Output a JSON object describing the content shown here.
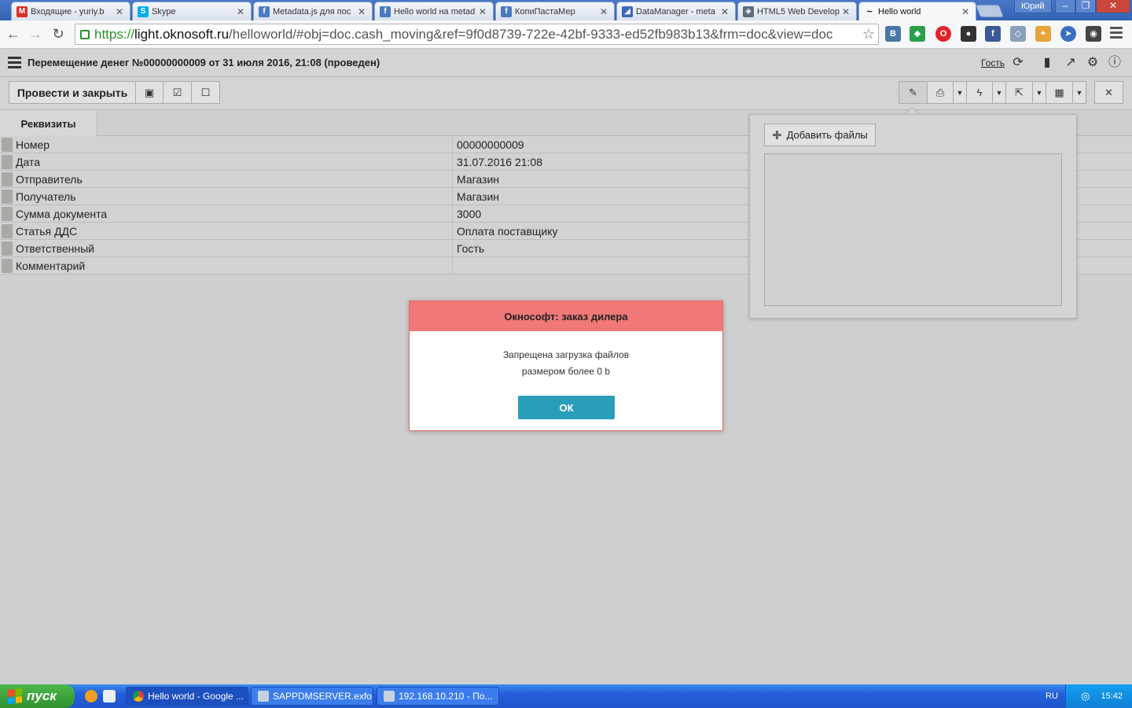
{
  "browser": {
    "tabs": [
      {
        "label": "Входящие - yuriy.b",
        "color": "#d93025",
        "glyph": "M"
      },
      {
        "label": "Skype",
        "color": "#00aff0",
        "glyph": "S"
      },
      {
        "label": "Metadata.js для пос",
        "color": "#4c79c4",
        "glyph": "f"
      },
      {
        "label": "Hello world на metad",
        "color": "#4c79c4",
        "glyph": "f"
      },
      {
        "label": "КопиПастаМер",
        "color": "#4c79c4",
        "glyph": "f"
      },
      {
        "label": "DataManager - meta",
        "color": "#3a68b8",
        "glyph": "◢"
      },
      {
        "label": "HTML5 Web Develop",
        "color": "#5f6b7a",
        "glyph": "◈"
      },
      {
        "label": "Hello world",
        "color": "#333333",
        "glyph": "~"
      }
    ],
    "window_user": "Юрий",
    "url": {
      "scheme": "https://",
      "host": "light.oknosoft.ru",
      "path": "/helloworld/#obj=doc.cash_moving&ref=9f0d8739-722e-42bf-9333-ed52fb983b13&frm=doc&view=doc"
    }
  },
  "app": {
    "title": "Перемещение денег №00000000009 от 31 июля 2016, 21:08 (проведен)",
    "user_link": "Гость"
  },
  "form_toolbar": {
    "post_close_label": "Провести и закрыть"
  },
  "form": {
    "tab_label": "Реквизиты",
    "fields": [
      {
        "label": "Номер",
        "value": "00000000009"
      },
      {
        "label": "Дата",
        "value": "31.07.2016 21:08"
      },
      {
        "label": "Отправитель",
        "value": "Магазин"
      },
      {
        "label": "Получатель",
        "value": "Магазин"
      },
      {
        "label": "Сумма документа",
        "value": "3000"
      },
      {
        "label": "Статья ДДС",
        "value": "Оплата поставщику"
      },
      {
        "label": "Ответственный",
        "value": "Гость"
      },
      {
        "label": "Комментарий",
        "value": ""
      }
    ]
  },
  "attachments": {
    "add_files_label": "Добавить файлы"
  },
  "modal": {
    "title": "Окнософт: заказ дилера",
    "message_line1": "Запрещена загрузка файлов",
    "message_line2": "размером более 0 b",
    "ok_label": "ОК"
  },
  "taskbar": {
    "start_label": "пуск",
    "tasks": [
      {
        "label": "Hello world - Google ..."
      },
      {
        "label": "SAPPDMSERVER.exfo..."
      },
      {
        "label": "192.168.10.210 - По..."
      }
    ],
    "language": "RU",
    "clock": "15:42"
  }
}
